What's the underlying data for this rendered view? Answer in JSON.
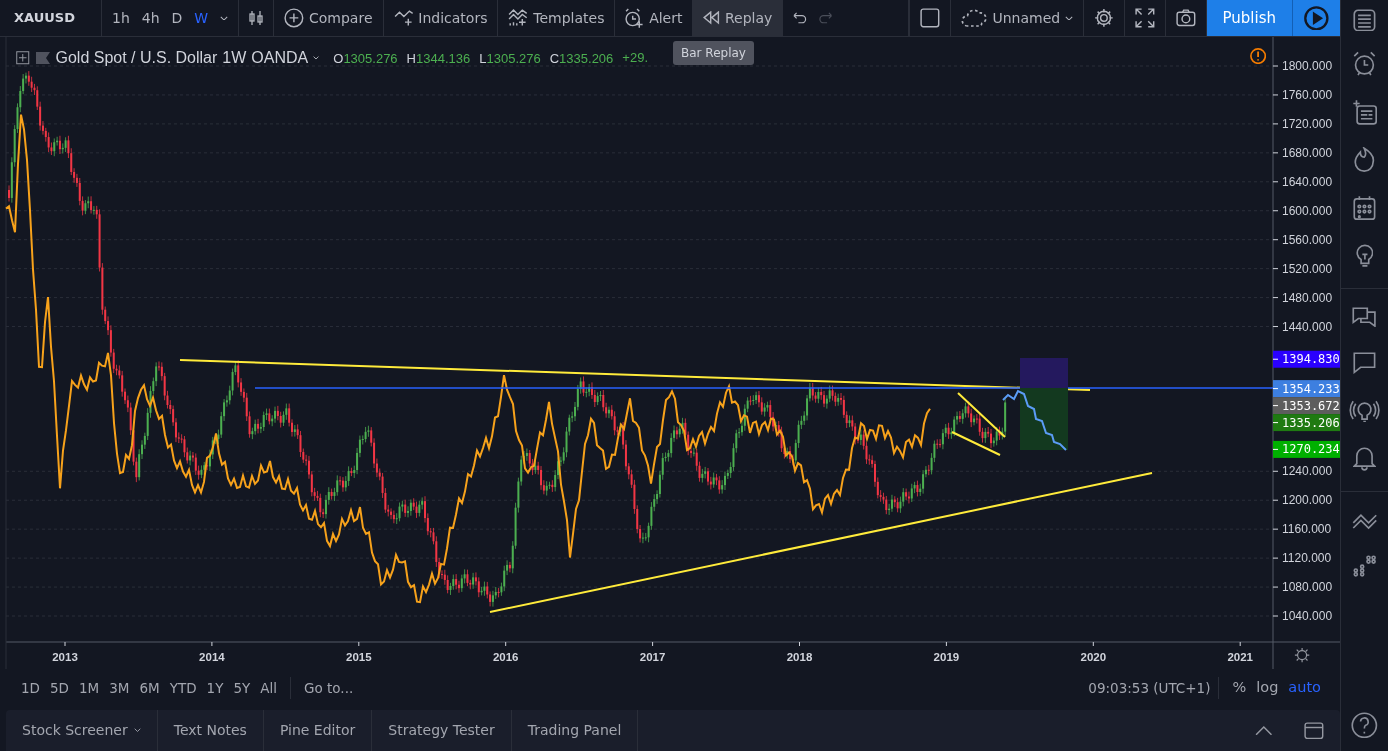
{
  "toolbar": {
    "symbol": "XAUUSD",
    "intervals": [
      {
        "label": "1h",
        "selected": false
      },
      {
        "label": "4h",
        "selected": false
      },
      {
        "label": "D",
        "selected": false
      },
      {
        "label": "W",
        "selected": true
      }
    ],
    "tools": [
      {
        "label": "Compare",
        "kind": "compare",
        "active": false
      },
      {
        "label": "Indicators",
        "kind": "indicators",
        "active": false
      },
      {
        "label": "Templates",
        "kind": "templates",
        "active": false
      },
      {
        "label": "Alert",
        "kind": "alert",
        "active": false
      },
      {
        "label": "Replay",
        "kind": "replay",
        "active": true
      }
    ],
    "undo": {
      "disabled": false
    },
    "redo": {
      "disabled": true
    },
    "layout_name": "Unnamed",
    "publish": "Publish"
  },
  "tooltip": "Bar Replay",
  "legend": {
    "title": "Gold Spot / U.S. Dollar",
    "interval": "1W",
    "source": "OANDA",
    "values": [
      {
        "key": "O",
        "value": "1305.276"
      },
      {
        "key": "H",
        "value": "1344.136"
      },
      {
        "key": "L",
        "value": "1305.276"
      },
      {
        "key": "C",
        "value": "1335.206"
      }
    ],
    "change": "+29."
  },
  "price_axis": {
    "labels": [
      "1800.000",
      "1760.000",
      "1720.000",
      "1680.000",
      "1640.000",
      "1600.000",
      "1560.000",
      "1520.000",
      "1480.000",
      "1440.000",
      "1240.000",
      "1200.000",
      "1160.000",
      "1120.000",
      "1080.000",
      "1040.000"
    ],
    "tags": [
      {
        "value": "1394.830",
        "color": "#2a00ff"
      },
      {
        "value": "1354.233",
        "color": "#3d7fe0"
      },
      {
        "value": "1353.672",
        "color": "#5d5d5d"
      },
      {
        "value": "1335.206",
        "color": "#1f7a12"
      },
      {
        "value": "1270.234",
        "color": "#00b000"
      }
    ]
  },
  "time_axis": [
    "2013",
    "2014",
    "2015",
    "2016",
    "2017",
    "2018",
    "2019",
    "2020",
    "2021"
  ],
  "ranges": [
    "1D",
    "5D",
    "1M",
    "3M",
    "6M",
    "YTD",
    "1Y",
    "5Y",
    "All"
  ],
  "goto": "Go to...",
  "clock": "09:03:53 (UTC+1)",
  "scale_options": [
    {
      "label": "%",
      "selected": false
    },
    {
      "label": "log",
      "selected": false
    },
    {
      "label": "auto",
      "selected": true
    }
  ],
  "bottom_tabs": [
    {
      "label": "Stock Screener",
      "has_menu": true
    },
    {
      "label": "Text Notes",
      "has_menu": false
    },
    {
      "label": "Pine Editor",
      "has_menu": false
    },
    {
      "label": "Strategy Tester",
      "has_menu": false
    },
    {
      "label": "Trading Panel",
      "has_menu": false
    }
  ]
}
